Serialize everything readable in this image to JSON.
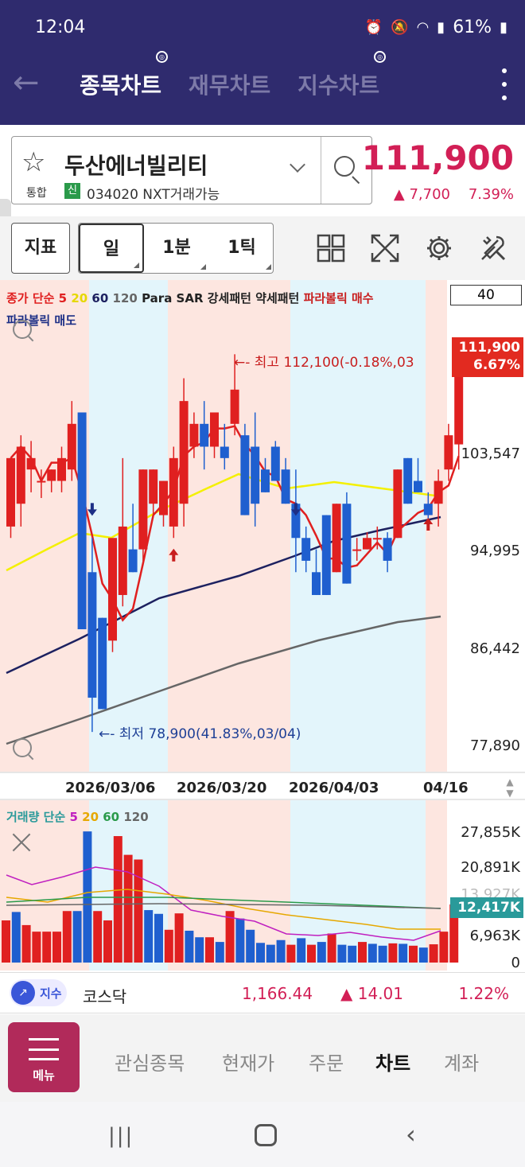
{
  "status": {
    "time": "12:04",
    "battery": "61%"
  },
  "header": {
    "tabs": [
      {
        "label": "종목차트",
        "active": true
      },
      {
        "label": "재무차트",
        "active": false
      },
      {
        "label": "지수차트",
        "active": false
      }
    ]
  },
  "stock": {
    "name": "두산에너빌리티",
    "market_label": "통합",
    "credit_badge": "신",
    "code_text": "034020 NXT거래가능",
    "price": "111,900",
    "change": "▲ 7,700",
    "change_pct": "7.39%"
  },
  "toolbar": {
    "indicator_label": "지표",
    "periods": [
      {
        "label": "일",
        "selected": true
      },
      {
        "label": "1분",
        "selected": false
      },
      {
        "label": "1틱",
        "selected": false
      }
    ],
    "icons": [
      "grid-layout-icon",
      "fullscreen-icon",
      "gear-icon",
      "tools-icon"
    ]
  },
  "chart": {
    "legend_items": [
      {
        "text": "종가 단순 5",
        "color": "#e02020"
      },
      {
        "text": " 20",
        "color": "#e6d800"
      },
      {
        "text": " 60",
        "color": "#1d2160"
      },
      {
        "text": " 120",
        "color": "#666666"
      },
      {
        "text": " Para SAR 강세패턴 약세패턴",
        "color": "#222222"
      },
      {
        "text": " 파라볼릭 매수",
        "color": "#c81e1e"
      }
    ],
    "legend_line2": "파라볼릭 매도",
    "period_value": "40",
    "current_price_tag": "111,900",
    "current_pct_tag": "6.67%",
    "high_annotation": "최고 112,100(-0.18%,03",
    "low_annotation": "최저 78,900(41.83%,03/04)",
    "price_axis": [
      "103,547",
      "94,995",
      "86,442",
      "77,890"
    ],
    "date_labels": [
      "2026/03/06",
      "2026/03/20",
      "2026/04/03",
      "04/16"
    ],
    "volume_legend_items": [
      {
        "text": "거래량 단순",
        "color": "#2a9a9a"
      },
      {
        "text": " 5",
        "color": "#c020c0"
      },
      {
        "text": " 20",
        "color": "#e6a800"
      },
      {
        "text": " 60",
        "color": "#2a9a4a"
      },
      {
        "text": " 120",
        "color": "#666666"
      }
    ],
    "volume_axis": [
      "27,855K",
      "20,891K",
      "13,927K",
      "6,963K",
      "0"
    ],
    "current_volume_tag": "12,417K",
    "colors": {
      "up": "#e02020",
      "down": "#1f5fcf",
      "ma5": "#e02020",
      "ma20": "#f4f000",
      "ma60": "#1d2160",
      "ma120": "#666666"
    }
  },
  "chart_data": {
    "type": "candlestick",
    "y_ticks": [
      103547,
      94995,
      86442,
      77890
    ],
    "volume_ticks_k": [
      27855,
      20891,
      13927,
      6963,
      0
    ],
    "candles": [
      {
        "o": 97,
        "h": 103,
        "l": 96,
        "c": 103
      },
      {
        "o": 99,
        "h": 105,
        "l": 97,
        "c": 104
      },
      {
        "o": 102,
        "h": 104.5,
        "l": 100,
        "c": 103
      },
      {
        "o": 101,
        "h": 102,
        "l": 99.5,
        "c": 101
      },
      {
        "o": 101,
        "h": 102,
        "l": 100,
        "c": 102
      },
      {
        "o": 101,
        "h": 104,
        "l": 100,
        "c": 103
      },
      {
        "o": 102,
        "h": 108,
        "l": 101,
        "c": 106
      },
      {
        "o": 107,
        "h": 107,
        "l": 88,
        "c": 88
      },
      {
        "o": 93,
        "h": 96,
        "l": 79,
        "c": 82
      },
      {
        "o": 89,
        "h": 89,
        "l": 81,
        "c": 81
      },
      {
        "o": 87,
        "h": 89,
        "l": 86,
        "c": 96
      },
      {
        "o": 91,
        "h": 103,
        "l": 90,
        "c": 97
      },
      {
        "o": 95,
        "h": 99,
        "l": 93,
        "c": 93
      },
      {
        "o": 95,
        "h": 102,
        "l": 94,
        "c": 102
      },
      {
        "o": 99,
        "h": 102,
        "l": 98,
        "c": 102
      },
      {
        "o": 98,
        "h": 101,
        "l": 97,
        "c": 101
      },
      {
        "o": 97,
        "h": 104,
        "l": 96,
        "c": 103
      },
      {
        "o": 99,
        "h": 110,
        "l": 97,
        "c": 108
      },
      {
        "o": 104,
        "h": 107,
        "l": 103,
        "c": 106
      },
      {
        "o": 106,
        "h": 108,
        "l": 102,
        "c": 104
      },
      {
        "o": 104,
        "h": 106,
        "l": 103,
        "c": 107
      },
      {
        "o": 104,
        "h": 106,
        "l": 102,
        "c": 103
      },
      {
        "o": 106,
        "h": 112.1,
        "l": 105,
        "c": 109
      },
      {
        "o": 105,
        "h": 106,
        "l": 98,
        "c": 98
      },
      {
        "o": 104,
        "h": 107,
        "l": 97,
        "c": 99
      },
      {
        "o": 102,
        "h": 103,
        "l": 100,
        "c": 100
      },
      {
        "o": 104,
        "h": 104.5,
        "l": 101,
        "c": 101
      },
      {
        "o": 102,
        "h": 103,
        "l": 99,
        "c": 99
      },
      {
        "o": 99,
        "h": 102,
        "l": 93,
        "c": 96
      },
      {
        "o": 96,
        "h": 97,
        "l": 93,
        "c": 94
      },
      {
        "o": 93,
        "h": 95,
        "l": 91,
        "c": 91
      },
      {
        "o": 98,
        "h": 98,
        "l": 91,
        "c": 91
      },
      {
        "o": 93,
        "h": 99,
        "l": 93,
        "c": 99
      },
      {
        "o": 99,
        "h": 100,
        "l": 92,
        "c": 92
      },
      {
        "o": 95,
        "h": 96,
        "l": 94,
        "c": 95
      },
      {
        "o": 95,
        "h": 96.5,
        "l": 95,
        "c": 96
      },
      {
        "o": 96,
        "h": 97,
        "l": 95,
        "c": 96
      },
      {
        "o": 96,
        "h": 96.5,
        "l": 93,
        "c": 94
      },
      {
        "o": 96,
        "h": 102,
        "l": 96,
        "c": 102
      },
      {
        "o": 103,
        "h": 103,
        "l": 99,
        "c": 99
      },
      {
        "o": 101,
        "h": 103,
        "l": 100,
        "c": 100
      },
      {
        "o": 99,
        "h": 100,
        "l": 97,
        "c": 98
      },
      {
        "o": 99,
        "h": 102,
        "l": 97,
        "c": 101
      },
      {
        "o": 102,
        "h": 106,
        "l": 101,
        "c": 105
      },
      {
        "o": 104.2,
        "h": 112.1,
        "l": 102,
        "c": 111.9
      }
    ],
    "volume_k": [
      9000,
      10800,
      8000,
      6600,
      6600,
      6600,
      11000,
      11000,
      28000,
      11000,
      9000,
      27000,
      23000,
      22000,
      11200,
      10400,
      7000,
      10500,
      6800,
      5400,
      5400,
      4400,
      11000,
      9400,
      7000,
      4200,
      3800,
      4800,
      3800,
      5200,
      3800,
      4400,
      6200,
      3800,
      3600,
      4400,
      4000,
      3600,
      4100,
      4000,
      3600,
      3200,
      3900,
      6600,
      12417
    ],
    "vol_up": [
      true,
      false,
      true,
      true,
      true,
      true,
      true,
      false,
      false,
      true,
      true,
      true,
      true,
      true,
      false,
      false,
      true,
      true,
      false,
      false,
      true,
      false,
      true,
      false,
      false,
      false,
      false,
      false,
      true,
      false,
      true,
      false,
      true,
      false,
      false,
      true,
      false,
      false,
      true,
      false,
      true,
      false,
      true,
      true,
      true
    ]
  },
  "index_bar": {
    "badge_icon": "trend-up-icon",
    "badge_label": "지수",
    "name": "코스닥",
    "value": "1,166.44",
    "change": "▲ 14.01",
    "change_pct": "1.22%"
  },
  "bottom_nav": {
    "menu_label": "메뉴",
    "items": [
      {
        "label": "관심종목",
        "active": false
      },
      {
        "label": "현재가",
        "active": false
      },
      {
        "label": "주문",
        "active": false
      },
      {
        "label": "차트",
        "active": true
      },
      {
        "label": "계좌",
        "active": false
      }
    ]
  }
}
